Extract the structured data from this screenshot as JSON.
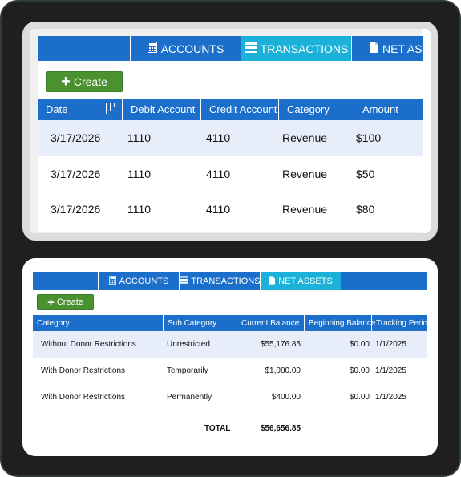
{
  "card1": {
    "tabs": [
      {
        "label": "",
        "icon": "blank"
      },
      {
        "label": "ACCOUNTS",
        "icon": "calculator-icon"
      },
      {
        "label": "TRANSACTIONS",
        "icon": "list-icon"
      },
      {
        "label": "NET ASSETS",
        "icon": "document-icon"
      }
    ],
    "active_tab": "TRANSACTIONS",
    "create_label": "Create",
    "columns": [
      "Date",
      "Debit Account",
      "Credit Account",
      "Category",
      "Amount"
    ],
    "rows": [
      [
        "3/17/2026",
        "1110",
        "4110",
        "Revenue",
        "$100"
      ],
      [
        "3/17/2026",
        "1110",
        "4110",
        "Revenue",
        "$50"
      ],
      [
        "3/17/2026",
        "1110",
        "4110",
        "Revenue",
        "$80"
      ]
    ]
  },
  "card2": {
    "tabs": [
      {
        "label": "",
        "icon": "blank"
      },
      {
        "label": "ACCOUNTS",
        "icon": "calculator-icon"
      },
      {
        "label": "TRANSACTIONS",
        "icon": "list-icon"
      },
      {
        "label": "NET ASSETS",
        "icon": "document-icon"
      }
    ],
    "active_tab": "NET ASSETS",
    "create_label": "Create",
    "columns": [
      "Category",
      "Sub Category",
      "Current Balance",
      "Beginning Balance",
      "Tracking Period"
    ],
    "rows": [
      [
        "Without Donor Restrictions",
        "Unrestricted",
        "$55,176.85",
        "$0.00",
        "1/1/2025"
      ],
      [
        "With Donor Restrictions",
        "Temporarily",
        "$1,080.00",
        "$0.00",
        "1/1/2025"
      ],
      [
        "With Donor Restrictions",
        "Permanently",
        "$400.00",
        "$0.00",
        "1/1/2025"
      ]
    ],
    "total_label": "TOTAL",
    "total_value": "$56,656.85"
  },
  "colors": {
    "primary_blue": "#1b6fcb",
    "active_tab": "#1bb1d8",
    "create_green": "#4a9130",
    "row_alt": "#e7eef9"
  }
}
